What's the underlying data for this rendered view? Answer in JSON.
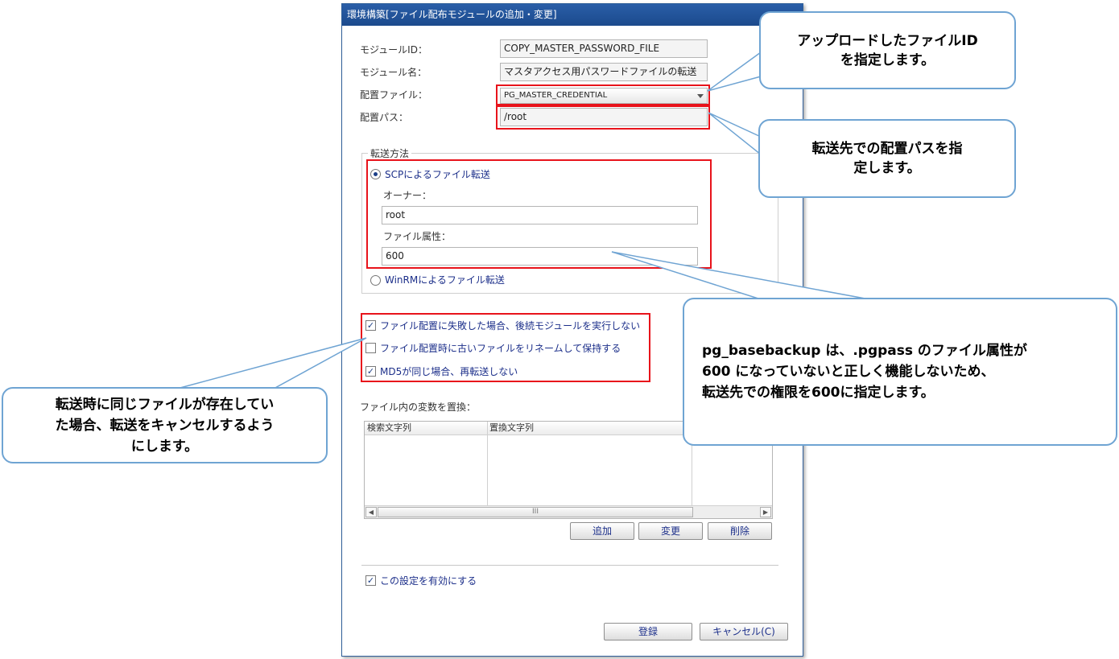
{
  "dialog": {
    "title": "環境構築[ファイル配布モジュールの追加・変更]",
    "module_id_label": "モジュールID：",
    "module_id_value": "COPY_MASTER_PASSWORD_FILE",
    "module_name_label": "モジュール名：",
    "module_name_value": "マスタアクセス用パスワードファイルの転送",
    "deploy_file_label": "配置ファイル：",
    "deploy_file_value": "PG_MASTER_CREDENTIAL",
    "deploy_path_label": "配置パス：",
    "deploy_path_value": "/root",
    "transfer": {
      "legend": "転送方法",
      "scp_label": "SCPによるファイル転送",
      "scp_selected": true,
      "owner_label": "オーナー：",
      "owner_value": "root",
      "attr_label": "ファイル属性：",
      "attr_value": "600",
      "winrm_label": "WinRMによるファイル転送"
    },
    "options": [
      {
        "label": "ファイル配置に失敗した場合、後続モジュールを実行しない",
        "checked": true
      },
      {
        "label": "ファイル配置時に古いファイルをリネームして保持する",
        "checked": false
      },
      {
        "label": "MD5が同じ場合、再転送しない",
        "checked": true
      }
    ],
    "replace": {
      "label": "ファイル内の変数を置換：",
      "columns": [
        "検索文字列",
        "置換文字列"
      ],
      "scroll_thumb": "III",
      "add_button": "追加",
      "edit_button": "変更",
      "delete_button": "削除"
    },
    "enable_label": "この設定を有効にする",
    "enable_checked": true,
    "register_button": "登録",
    "cancel_button": "キャンセル(C)"
  },
  "callouts": {
    "file_id": [
      "アップロードしたファイルID",
      "を指定します。"
    ],
    "path": [
      "転送先での配置パスを指",
      "定します。"
    ],
    "attr": [
      "pg_basebackup は、.pgpass のファイル属性が",
      "600 になっていないと正しく機能しないため、",
      "転送先での権限を600に指定します。"
    ],
    "md5": [
      "転送時に同じファイルが存在してい",
      "た場合、転送をキャンセルするよう",
      "にします。"
    ]
  },
  "colors": {
    "title_bar": "#1f4f94",
    "highlight": "#e8131b",
    "callout_border": "#6fa4d3",
    "link_text": "#1c2f8a"
  }
}
